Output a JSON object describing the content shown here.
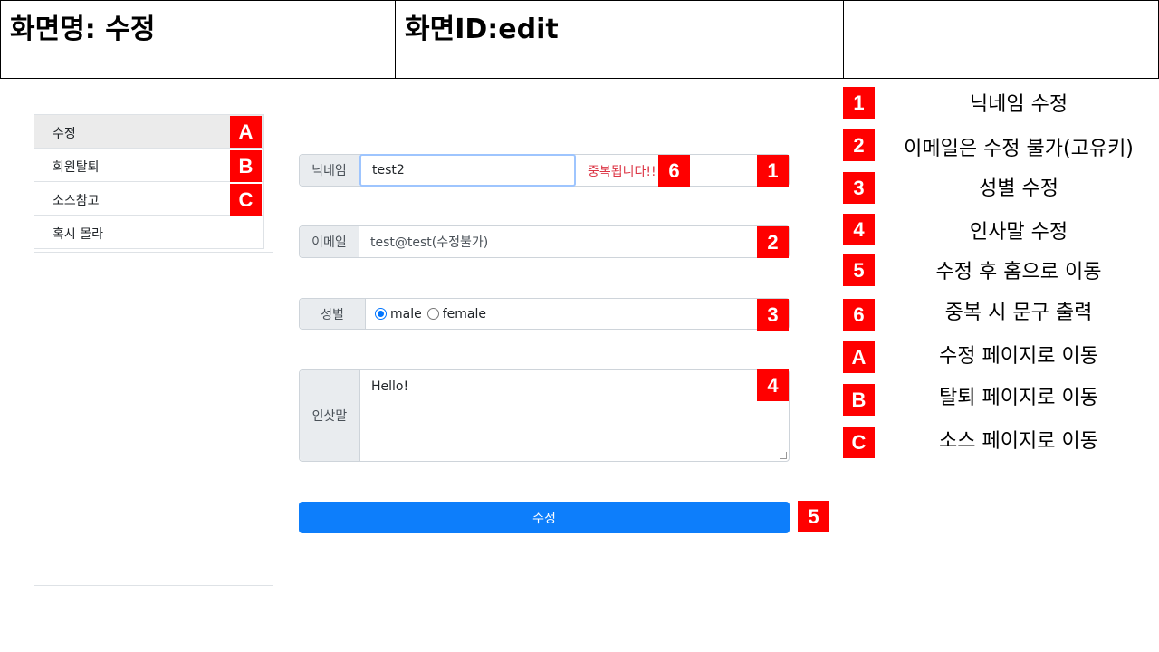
{
  "header": {
    "screen_name": "화면명: 수정",
    "screen_id": "화면ID:edit",
    "extra": ""
  },
  "sidebar": {
    "items": [
      {
        "label": "수정",
        "active": true
      },
      {
        "label": "회원탈퇴"
      },
      {
        "label": "소스참고"
      },
      {
        "label": "혹시 몰라"
      }
    ]
  },
  "form": {
    "nickname": {
      "label": "닉네임",
      "value": "test2",
      "error": "중복됩니다!!"
    },
    "email": {
      "label": "이메일",
      "value": "test@test(수정불가)"
    },
    "gender": {
      "label": "성별",
      "options": [
        "male",
        "female"
      ],
      "selected": "male"
    },
    "greeting": {
      "label": "인삿말",
      "value": "Hello!"
    },
    "submit_label": "수정"
  },
  "markers": {
    "m1": "1",
    "m2": "2",
    "m3": "3",
    "m4": "4",
    "m5": "5",
    "m6": "6",
    "mA": "A",
    "mB": "B",
    "mC": "C"
  },
  "legend": [
    {
      "key": "1",
      "text": "닉네임 수정"
    },
    {
      "key": "2",
      "text": "이메일은 수정 불가(고유키)"
    },
    {
      "key": "3",
      "text": "성별 수정"
    },
    {
      "key": "4",
      "text": "인사말 수정"
    },
    {
      "key": "5",
      "text": "수정 후 홈으로 이동"
    },
    {
      "key": "6",
      "text": "중복 시 문구 출력"
    },
    {
      "key": "A",
      "text": "수정 페이지로 이동"
    },
    {
      "key": "B",
      "text": "탈퇴 페이지로 이동"
    },
    {
      "key": "C",
      "text": "소스 페이지로 이동"
    }
  ],
  "colors": {
    "marker": "#ff0000",
    "primary": "#0d7efb",
    "error": "#dc3545"
  }
}
